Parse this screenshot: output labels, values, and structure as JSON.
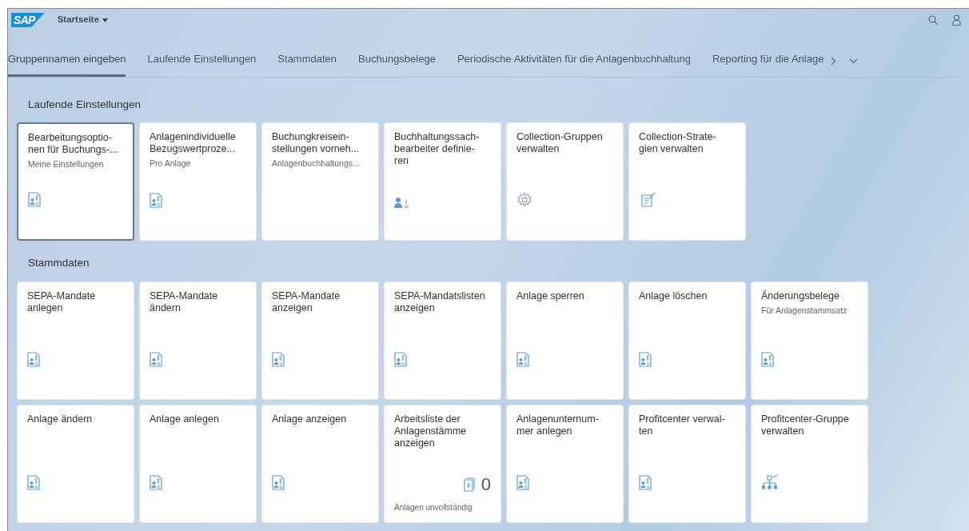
{
  "header": {
    "logo": "SAP",
    "title": "Startseite"
  },
  "tabs": [
    {
      "label": "Gruppennamen eingeben",
      "selected": true
    },
    {
      "label": "Laufende Einstellungen",
      "selected": false
    },
    {
      "label": "Stammdaten",
      "selected": false
    },
    {
      "label": "Buchungsbelege",
      "selected": false
    },
    {
      "label": "Periodische Aktivitäten für die Anlagenbuchhaltung",
      "selected": false
    },
    {
      "label": "Reporting für die Anlage",
      "selected": false
    }
  ],
  "sections": [
    {
      "title": "Laufende Einstellungen",
      "rows": [
        [
          {
            "title": "Bearbeitungsoptio-\nnen für Buchungs-...",
            "subtitle": "Meine Einstellungen",
            "kind": "doc",
            "focused": true
          },
          {
            "title": "Anlagenindividuelle\nBezugswertproze...",
            "subtitle": "Pro Anlage",
            "kind": "doc",
            "focused": false
          },
          {
            "title": "Buchungkreisein-\nstellungen vorneh...",
            "subtitle": "Anlagenbuchhaltungs...",
            "focused": false
          },
          {
            "title": "Buchhaltungssach-\nbearbeiter definie-\nren",
            "kind": "person",
            "focused": false
          },
          {
            "title": "Collection-Gruppen\nverwalten",
            "kind": "gear",
            "focused": false
          },
          {
            "title": "Collection-Strate-\ngien verwalten",
            "kind": "form",
            "focused": false
          }
        ]
      ]
    },
    {
      "title": "Stammdaten",
      "rows": [
        [
          {
            "title": "SEPA-Mandate\nanlegen",
            "kind": "doc",
            "focused": false
          },
          {
            "title": "SEPA-Mandate\nändern",
            "kind": "doc",
            "focused": false
          },
          {
            "title": "SEPA-Mandate\nanzeigen",
            "kind": "doc",
            "focused": false
          },
          {
            "title": "SEPA-Mandatslisten\nanzeigen",
            "kind": "doc",
            "focused": false
          },
          {
            "title": "Anlage sperren",
            "kind": "doc",
            "focused": false
          },
          {
            "title": "Anlage löschen",
            "kind": "doc",
            "focused": false
          },
          {
            "title": "Änderungsbelege",
            "subtitle": "Für Anlagenstammsatz",
            "kind": "doc",
            "focused": false
          }
        ],
        [
          {
            "title": "Anlage ändern",
            "kind": "doc",
            "focused": false
          },
          {
            "title": "Anlage anlegen",
            "kind": "doc",
            "focused": false
          },
          {
            "title": "Anlage anzeigen",
            "kind": "doc",
            "focused": false
          },
          {
            "title": "Arbeitsliste der\nAnlagenstämme\nanzeigen",
            "kind": "counter",
            "count": "0",
            "footer": "Anlagen unvollständig",
            "focused": false
          },
          {
            "title": "Anlagenunternum-\nmer anlegen",
            "kind": "doc",
            "focused": false
          },
          {
            "title": "Profitcenter verwal-\nten",
            "kind": "doc",
            "focused": false
          },
          {
            "title": "Profitcenter-Gruppe\nverwalten",
            "kind": "hierarchy",
            "focused": false
          }
        ]
      ]
    }
  ]
}
